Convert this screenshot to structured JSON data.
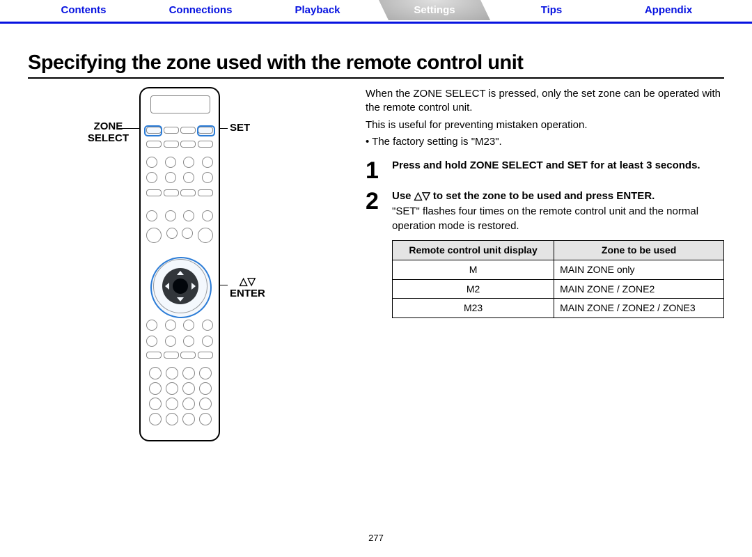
{
  "nav": {
    "items": [
      {
        "label": "Contents",
        "active": false
      },
      {
        "label": "Connections",
        "active": false
      },
      {
        "label": "Playback",
        "active": false
      },
      {
        "label": "Settings",
        "active": true
      },
      {
        "label": "Tips",
        "active": false
      },
      {
        "label": "Appendix",
        "active": false
      }
    ]
  },
  "heading": "Specifying the zone used with the remote control unit",
  "callouts": {
    "zone_select": "ZONE\nSELECT",
    "set": "SET",
    "nav": "△▽\nENTER"
  },
  "intro": {
    "p1": "When the ZONE SELECT is pressed, only the set zone can be operated with the remote control unit.",
    "p2": "This is useful for preventing mistaken operation.",
    "bullet1": "The factory setting is \"M23\"."
  },
  "steps": [
    {
      "num": "1",
      "title": "Press and hold ZONE SELECT and SET for at least 3 seconds."
    },
    {
      "num": "2",
      "title_prefix": "Use ",
      "title_arrows": "△▽",
      "title_suffix": " to set the zone to be used and press ENTER.",
      "note": "\"SET\" flashes four times on the remote control unit and the normal operation mode is restored."
    }
  ],
  "table": {
    "headers": [
      "Remote control unit display",
      "Zone to be used"
    ],
    "rows": [
      [
        "M",
        "MAIN ZONE only"
      ],
      [
        "M2",
        "MAIN ZONE / ZONE2"
      ],
      [
        "M23",
        "MAIN ZONE / ZONE2 / ZONE3"
      ]
    ]
  },
  "page_number": "277"
}
